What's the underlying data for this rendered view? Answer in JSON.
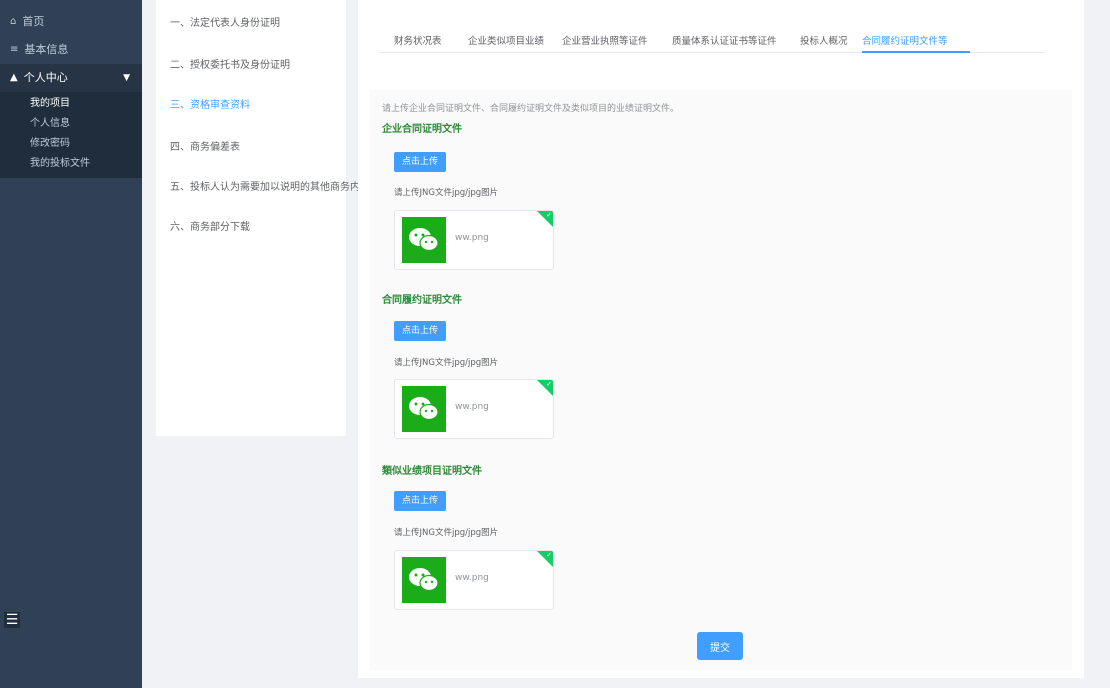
{
  "sidebar": {
    "items": [
      {
        "icon": "home-icon",
        "label": "首页"
      },
      {
        "icon": "info-icon",
        "label": "基本信息"
      },
      {
        "icon": "user-icon",
        "label": "个人中心"
      }
    ],
    "submenu": [
      "我的项目",
      "个人信息",
      "修改密码",
      "我的投标文件"
    ]
  },
  "steps": [
    "一、法定代表人身份证明",
    "二、授权委托书及身份证明",
    "三、资格审查资料",
    "四、商务偏差表",
    "五、投标人认为需要加以说明的其他商务内容",
    "六、商务部分下载"
  ],
  "tabs": [
    "财务状况表",
    "企业类似项目业绩",
    "企业营业执照等证件",
    "质量体系认证证书等证件",
    "投标人概况",
    "合同履约证明文件等"
  ],
  "content": {
    "hint": "请上传企业合同证明文件、合同履约证明文件及类似项目的业绩证明文件。",
    "sections": [
      {
        "title": "企业合同证明文件",
        "upload_label": "点击上传",
        "file_hint": "请上传JNG文件jpg/jpg图片",
        "file_name": "ww.png"
      },
      {
        "title": "合同履约证明文件",
        "upload_label": "点击上传",
        "file_hint": "请上传JNG文件jpg/jpg图片",
        "file_name": "ww.png"
      },
      {
        "title": "類似业绩项目证明文件",
        "upload_label": "点击上传",
        "file_hint": "请上传JNG文件jpg/jpg图片",
        "file_name": "ww.png"
      }
    ],
    "submit_label": "提交"
  },
  "colors": {
    "sidebar_bg": "#304156",
    "accent": "#409eff",
    "section_title": "#2e8b3a",
    "wechat_green": "#1aad19",
    "success_corner": "#13ce66"
  }
}
